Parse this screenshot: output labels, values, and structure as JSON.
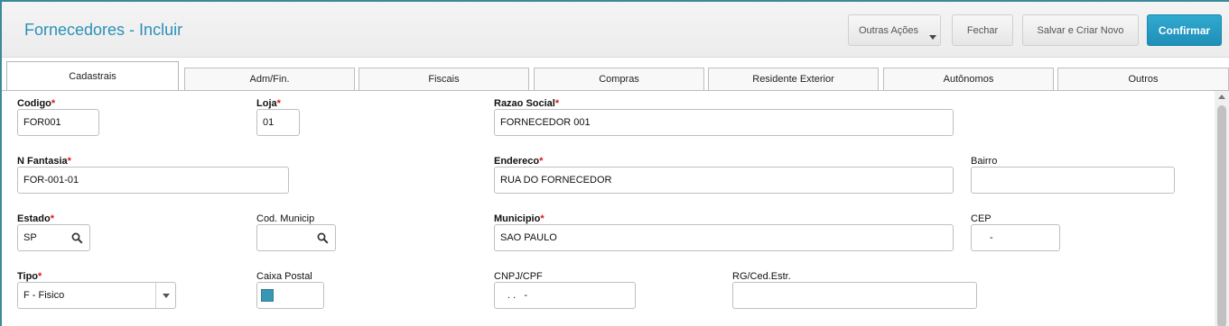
{
  "header": {
    "title": "Fornecedores - Incluir",
    "buttons": {
      "more": "Outras Ações",
      "close": "Fechar",
      "save_new": "Salvar e Criar Novo",
      "confirm": "Confirmar"
    }
  },
  "tabs": [
    {
      "label": "Cadastrais",
      "active": true
    },
    {
      "label": "Adm/Fin.",
      "active": false
    },
    {
      "label": "Fiscais",
      "active": false
    },
    {
      "label": "Compras",
      "active": false
    },
    {
      "label": "Residente Exterior",
      "active": false
    },
    {
      "label": "Autônomos",
      "active": false
    },
    {
      "label": "Outros",
      "active": false
    }
  ],
  "form": {
    "codigo": {
      "label": "Codigo",
      "required": true,
      "value": "FOR001"
    },
    "loja": {
      "label": "Loja",
      "required": true,
      "value": "01"
    },
    "razao_social": {
      "label": "Razao Social",
      "required": true,
      "value": "FORNECEDOR 001"
    },
    "n_fantasia": {
      "label": "N Fantasia",
      "required": true,
      "value": "FOR-001-01"
    },
    "endereco": {
      "label": "Endereco",
      "required": true,
      "value": "RUA DO FORNECEDOR"
    },
    "bairro": {
      "label": "Bairro",
      "required": false,
      "value": ""
    },
    "estado": {
      "label": "Estado",
      "required": true,
      "value": "SP"
    },
    "cod_municip": {
      "label": "Cod. Municip",
      "required": false,
      "value": ""
    },
    "municipio": {
      "label": "Municipio",
      "required": true,
      "value": "SAO PAULO"
    },
    "cep": {
      "label": "CEP",
      "required": false,
      "value": "-"
    },
    "tipo": {
      "label": "Tipo",
      "required": true,
      "value": "F - Fisico"
    },
    "caixa_postal": {
      "label": "Caixa Postal",
      "required": false,
      "value": ""
    },
    "cnpj_cpf": {
      "label": "CNPJ/CPF",
      "required": false,
      "value": ". .   -"
    },
    "rg_ced_estr": {
      "label": "RG/Ced.Estr.",
      "required": false,
      "value": ""
    }
  },
  "required_marker": "*",
  "colors": {
    "accent": "#2a91b8",
    "confirm_button": "#2a9fc6",
    "required_star": "#e01414",
    "swatch": "#3b96b3"
  }
}
